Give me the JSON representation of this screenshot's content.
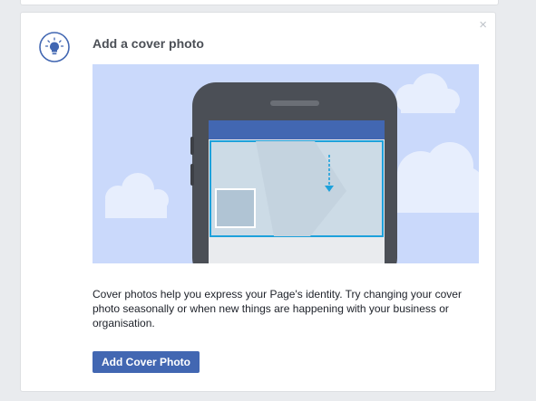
{
  "card": {
    "title": "Add a cover photo",
    "description": "Cover photos help you express your Page's identity. Try changing your cover photo seasonally or when new things are happening with your business or organisation.",
    "button_label": "Add Cover Photo",
    "close_glyph": "×"
  },
  "icons": {
    "tip": "lightbulb-icon",
    "close": "close-icon"
  },
  "colors": {
    "accent": "#4267b2",
    "sky": "#cad9fb",
    "highlight": "#1da1db"
  }
}
